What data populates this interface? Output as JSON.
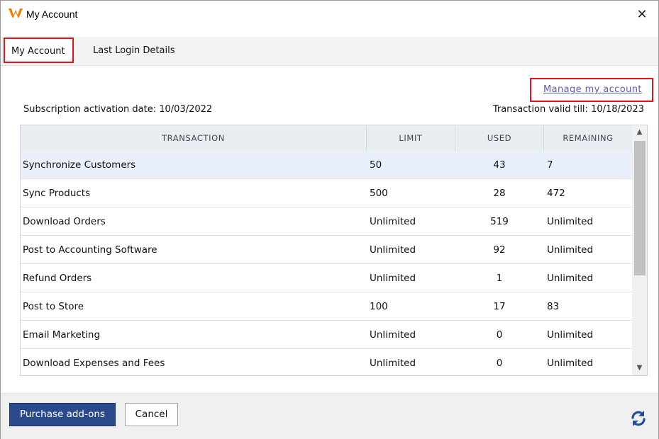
{
  "window": {
    "title": "My Account",
    "close_icon": "close-icon",
    "logo_icon": "app-logo-icon"
  },
  "tabs": [
    {
      "label": "My Account",
      "active": true
    },
    {
      "label": "Last Login Details",
      "active": false
    }
  ],
  "manage_link": "Manage my account",
  "info": {
    "activation": "Subscription activation date:  10/03/2022",
    "valid_till": "Transaction valid till:  10/18/2023"
  },
  "table": {
    "columns": [
      "TRANSACTION",
      "LIMIT",
      "USED",
      "REMAINING"
    ],
    "rows": [
      {
        "name": "Synchronize Customers",
        "limit": "50",
        "used": "43",
        "remaining": "7"
      },
      {
        "name": "Sync Products",
        "limit": "500",
        "used": "28",
        "remaining": "472"
      },
      {
        "name": "Download Orders",
        "limit": "Unlimited",
        "used": "519",
        "remaining": "Unlimited"
      },
      {
        "name": "Post to Accounting Software",
        "limit": "Unlimited",
        "used": "92",
        "remaining": "Unlimited"
      },
      {
        "name": "Refund Orders",
        "limit": "Unlimited",
        "used": "1",
        "remaining": "Unlimited"
      },
      {
        "name": "Post to Store",
        "limit": "100",
        "used": "17",
        "remaining": "83"
      },
      {
        "name": "Email Marketing",
        "limit": "Unlimited",
        "used": "0",
        "remaining": "Unlimited"
      },
      {
        "name": "Download Expenses and Fees",
        "limit": "Unlimited",
        "used": "0",
        "remaining": "Unlimited"
      }
    ],
    "selected_row": 0
  },
  "footer": {
    "purchase_label": "Purchase add-ons",
    "cancel_label": "Cancel",
    "refresh_icon": "refresh-icon"
  },
  "colors": {
    "accent": "#2b4a8c",
    "highlight_border": "#e8111b",
    "link": "#5a5ab0",
    "selected_row": "#eaf0fb",
    "header_bg": "#e9edf1",
    "logo_orange": "#f07c00",
    "refresh_blue": "#1f4e99"
  }
}
